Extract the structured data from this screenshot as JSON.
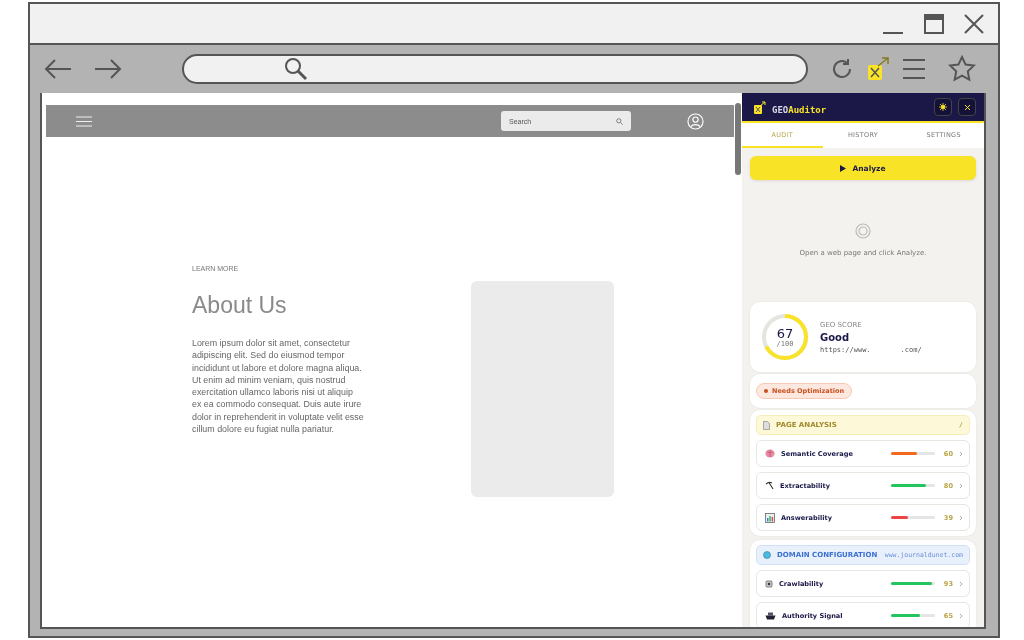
{
  "site": {
    "search_placeholder": "Search",
    "eyebrow": "LEARN MORE",
    "heading": "About Us",
    "paragraph": "Lorem ipsum dolor sit amet, consectetur adipiscing elit. Sed do eiusmod tempor incididunt ut labore et dolore magna aliqua. Ut enim ad minim veniam, quis nostrud exercitation ullamco laboris nisi ut aliquip ex ea commodo consequat. Duis aute irure dolor in reprehenderit in voluptate velit esse cillum dolore eu fugiat nulla pariatur."
  },
  "extension": {
    "brand_prefix": "GEO",
    "brand_suffix": "Auditor",
    "tabs": [
      {
        "label": "AUDIT",
        "selected": true
      },
      {
        "label": "HISTORY",
        "selected": false
      },
      {
        "label": "SETTINGS",
        "selected": false
      }
    ],
    "analyze_button": "Analyze",
    "empty_message": "Open a web page and click Analyze.",
    "score": {
      "value": "67",
      "max": "/100",
      "level": 0.67,
      "label": "GEO SCORE",
      "rating": "Good",
      "url_start": "https://www.",
      "url_end": ".com/"
    },
    "badge": "Needs Optimization",
    "sections": [
      {
        "kind": "page",
        "title": "PAGE ANALYSIS",
        "aside": "/",
        "metrics": [
          {
            "kind": "semantic",
            "name": "Semantic Coverage",
            "level": 0.6,
            "color": "#f26b1d",
            "value": "60"
          },
          {
            "kind": "extract",
            "name": "Extractability",
            "level": 0.8,
            "color": "#22c55e",
            "value": "80"
          },
          {
            "kind": "answer",
            "name": "Answerability",
            "level": 0.39,
            "color": "#ef4444",
            "value": "39"
          }
        ]
      },
      {
        "kind": "domain",
        "title": "DOMAIN CONFIGURATION",
        "aside": "www.journaldunet.com",
        "metrics": [
          {
            "kind": "crawl",
            "name": "Crawlability",
            "level": 0.93,
            "color": "#22c55e",
            "value": "93"
          },
          {
            "kind": "authority",
            "name": "Authority Signal",
            "level": 0.65,
            "color": "#22c55e",
            "value": "65"
          }
        ]
      }
    ]
  }
}
